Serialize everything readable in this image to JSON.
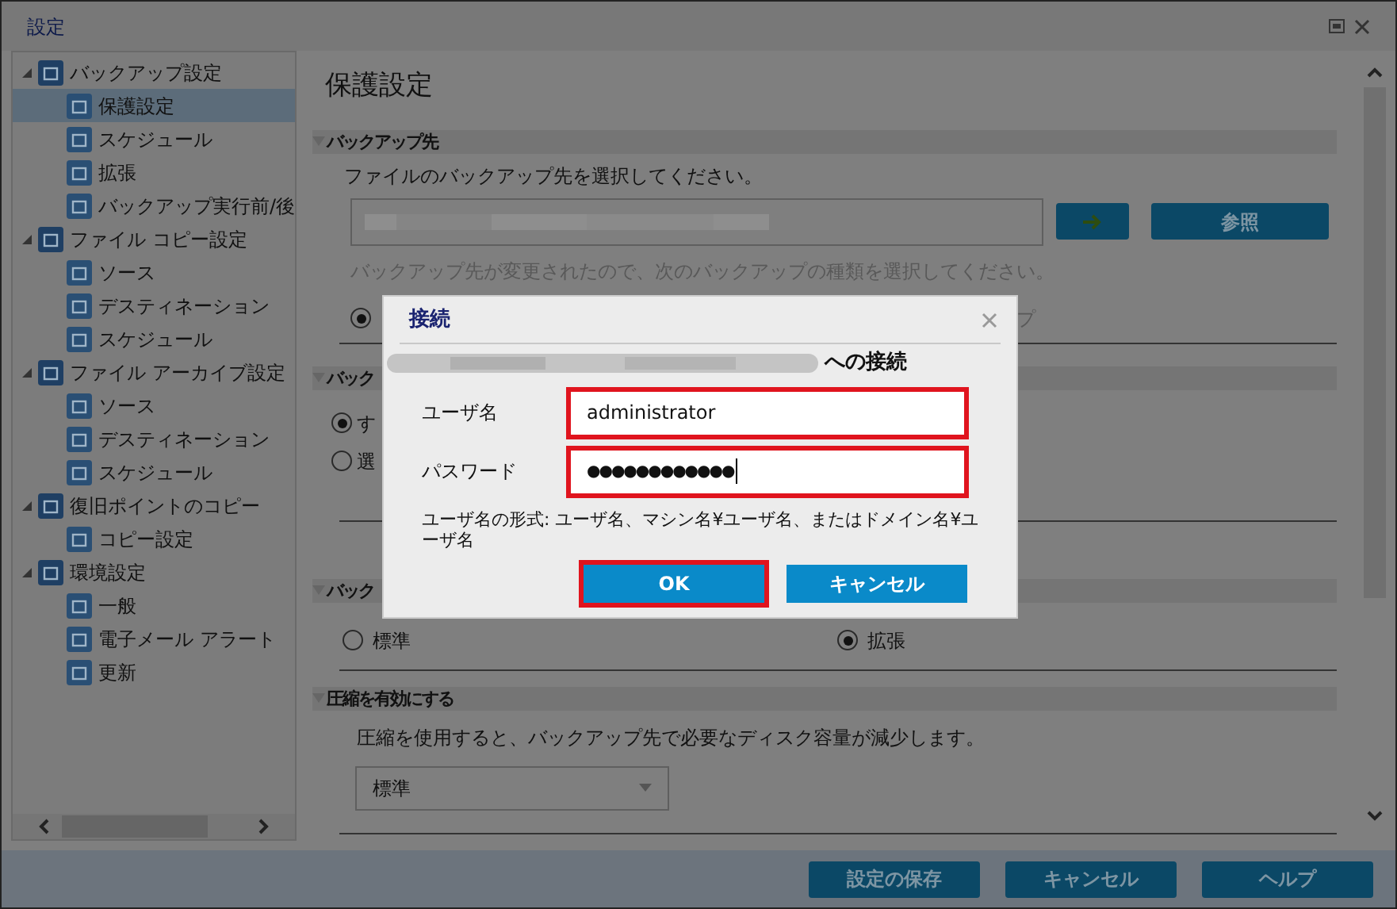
{
  "window": {
    "title": "設定"
  },
  "sidebar": {
    "items": [
      {
        "label": "バックアップ設定",
        "expanded": true,
        "selected": false,
        "children": [
          {
            "label": "保護設定",
            "selected": true
          },
          {
            "label": "スケジュール",
            "selected": false
          },
          {
            "label": "拡張",
            "selected": false
          },
          {
            "label": "バックアップ実行前/後",
            "selected": false
          }
        ]
      },
      {
        "label": "ファイル コピー設定",
        "expanded": true,
        "selected": false,
        "children": [
          {
            "label": "ソース",
            "selected": false
          },
          {
            "label": "デスティネーション",
            "selected": false
          },
          {
            "label": "スケジュール",
            "selected": false
          }
        ]
      },
      {
        "label": "ファイル アーカイブ設定",
        "expanded": true,
        "selected": false,
        "children": [
          {
            "label": "ソース",
            "selected": false
          },
          {
            "label": "デスティネーション",
            "selected": false
          },
          {
            "label": "スケジュール",
            "selected": false
          }
        ]
      },
      {
        "label": "復旧ポイントのコピー",
        "expanded": true,
        "selected": false,
        "children": [
          {
            "label": "コピー設定",
            "selected": false
          }
        ]
      },
      {
        "label": "環境設定",
        "expanded": true,
        "selected": false,
        "children": [
          {
            "label": "一般",
            "selected": false
          },
          {
            "label": "電子メール アラート",
            "selected": false
          },
          {
            "label": "更新",
            "selected": false
          }
        ]
      }
    ]
  },
  "main": {
    "heading": "保護設定",
    "destination": {
      "title": "バックアップ先",
      "description": "ファイルのバックアップ先を選択してください。",
      "browse_button": "参照",
      "notice": "バックアップ先が変更されたので、次のバックアップの種類を選択してください。",
      "radio_selected": true,
      "radio_tail": "プ"
    },
    "section2": {
      "title": "バック",
      "options": [
        {
          "label": "す",
          "selected": true
        },
        {
          "label": "選",
          "selected": false
        }
      ]
    },
    "section3": {
      "title": "バック",
      "options": [
        {
          "label": "標準",
          "selected": false
        },
        {
          "label": "拡張",
          "selected": true
        }
      ]
    },
    "compression": {
      "title": "圧縮を有効にする",
      "description": "圧縮を使用すると、バックアップ先で必要なディスク容量が減少します。",
      "value": "標準"
    }
  },
  "footer": {
    "buttons": [
      "設定の保存",
      "キャンセル",
      "ヘルプ"
    ]
  },
  "dialog": {
    "title": "接続",
    "target_suffix": "への接続",
    "fields": [
      {
        "label": "ユーザ名",
        "value": "administrator",
        "highlighted": true
      },
      {
        "label": "パスワード",
        "value": "●●●●●●●●●●●●",
        "highlighted": true
      }
    ],
    "hint": "ユーザ名の形式: ユーザ名、マシン名¥ユーザ名、またはドメイン名¥ユーザ名",
    "buttons": [
      {
        "label": "OK",
        "highlighted": true
      },
      {
        "label": "キャンセル",
        "highlighted": false
      }
    ]
  }
}
